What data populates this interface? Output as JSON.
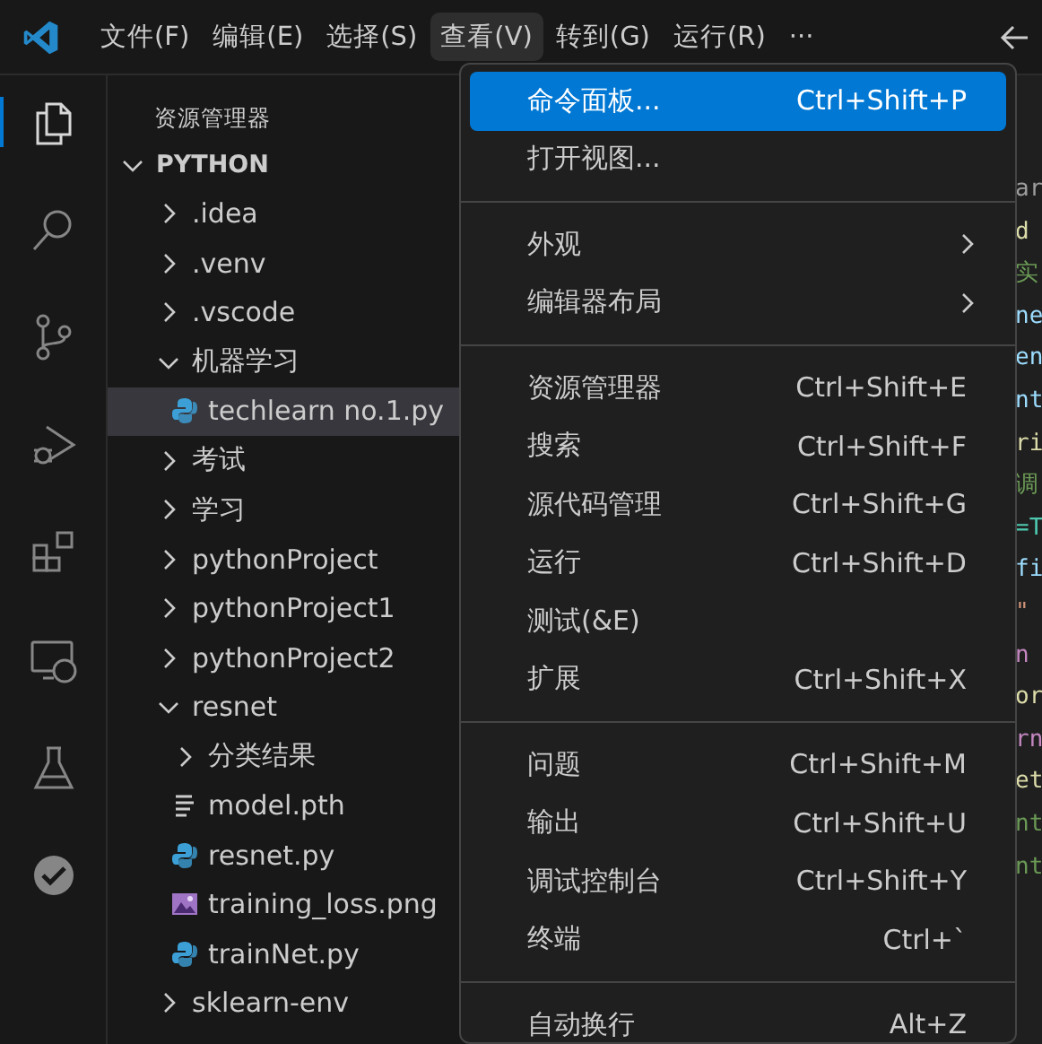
{
  "menubar": {
    "items": [
      {
        "label": "文件(F)",
        "selected": false
      },
      {
        "label": "编辑(E)",
        "selected": false
      },
      {
        "label": "选择(S)",
        "selected": false
      },
      {
        "label": "查看(V)",
        "selected": true
      },
      {
        "label": "转到(G)",
        "selected": false
      },
      {
        "label": "运行(R)",
        "selected": false
      },
      {
        "label": "···",
        "selected": false
      }
    ]
  },
  "activity_bar": {
    "items": [
      {
        "kind": "explorer",
        "selected": true
      },
      {
        "kind": "search",
        "selected": false
      },
      {
        "kind": "source-control",
        "selected": false
      },
      {
        "kind": "run-debug",
        "selected": false
      },
      {
        "kind": "extensions",
        "selected": false
      },
      {
        "kind": "remote",
        "selected": false
      },
      {
        "kind": "testing",
        "selected": false
      },
      {
        "kind": "check",
        "selected": false
      }
    ]
  },
  "sidebar": {
    "title": "资源管理器",
    "tree": {
      "label": "PYTHON",
      "expanded": true,
      "children": [
        {
          "kind": "folder",
          "label": ".idea",
          "expanded": false,
          "selected": false
        },
        {
          "kind": "folder",
          "label": ".venv",
          "expanded": false,
          "selected": false
        },
        {
          "kind": "folder",
          "label": ".vscode",
          "expanded": false,
          "selected": false
        },
        {
          "kind": "folder",
          "label": "机器学习",
          "expanded": true,
          "selected": false,
          "children": [
            {
              "kind": "python",
              "label": "techlearn no.1.py",
              "selected": true
            }
          ]
        },
        {
          "kind": "folder",
          "label": "考试",
          "expanded": false,
          "selected": false
        },
        {
          "kind": "folder",
          "label": "学习",
          "expanded": false,
          "selected": false
        },
        {
          "kind": "folder",
          "label": "pythonProject",
          "expanded": false,
          "selected": false
        },
        {
          "kind": "folder",
          "label": "pythonProject1",
          "expanded": false,
          "selected": false
        },
        {
          "kind": "folder",
          "label": "pythonProject2",
          "expanded": false,
          "selected": false
        },
        {
          "kind": "folder",
          "label": "resnet",
          "expanded": true,
          "selected": false,
          "children": [
            {
              "kind": "folder",
              "label": "分类结果",
              "expanded": false,
              "selected": false
            },
            {
              "kind": "lines",
              "label": "model.pth",
              "selected": false
            },
            {
              "kind": "python",
              "label": "resnet.py",
              "selected": false
            },
            {
              "kind": "image",
              "label": "training_loss.png",
              "selected": false
            },
            {
              "kind": "python",
              "label": "trainNet.py",
              "selected": false
            }
          ]
        },
        {
          "kind": "folder",
          "label": "sklearn-env",
          "expanded": false,
          "selected": false
        }
      ]
    }
  },
  "view_menu": {
    "groups": [
      {
        "items": [
          {
            "label": "命令面板...",
            "shortcut": "Ctrl+Shift+P",
            "selected": true,
            "submenu": false
          },
          {
            "label": "打开视图...",
            "selected": false,
            "submenu": false
          }
        ]
      },
      {
        "items": [
          {
            "label": "外观",
            "selected": false,
            "submenu": true
          },
          {
            "label": "编辑器布局",
            "selected": false,
            "submenu": true
          }
        ]
      },
      {
        "items": [
          {
            "label": "资源管理器",
            "shortcut": "Ctrl+Shift+E",
            "selected": false,
            "submenu": false
          },
          {
            "label": "搜索",
            "shortcut": "Ctrl+Shift+F",
            "selected": false,
            "submenu": false
          },
          {
            "label": "源代码管理",
            "shortcut": "Ctrl+Shift+G",
            "selected": false,
            "submenu": false
          },
          {
            "label": "运行",
            "shortcut": "Ctrl+Shift+D",
            "selected": false,
            "submenu": false
          },
          {
            "label": "测试(&E)",
            "selected": false,
            "submenu": false
          },
          {
            "label": "扩展",
            "shortcut": "Ctrl+Shift+X",
            "selected": false,
            "submenu": false
          }
        ]
      },
      {
        "items": [
          {
            "label": "问题",
            "shortcut": "Ctrl+Shift+M",
            "selected": false,
            "submenu": false
          },
          {
            "label": "输出",
            "shortcut": "Ctrl+Shift+U",
            "selected": false,
            "submenu": false
          },
          {
            "label": "调试控制台",
            "shortcut": "Ctrl+Shift+Y",
            "selected": false,
            "submenu": false
          },
          {
            "label": "终端",
            "shortcut": "Ctrl+`",
            "selected": false,
            "submenu": false
          }
        ]
      },
      {
        "items": [
          {
            "label": "自动换行",
            "shortcut": "Alt+Z",
            "selected": false,
            "submenu": false
          }
        ]
      }
    ]
  },
  "editor": {
    "fragments": [
      {
        "text": "ar",
        "color": "#9d9d9d"
      },
      {
        "text": "d",
        "color": "#dcdcaa"
      },
      {
        "text": "实",
        "color": "#6a9955"
      },
      {
        "text": "ne",
        "color": "#9cdcfe"
      },
      {
        "text": "en",
        "color": "#9cdcfe"
      },
      {
        "text": "nt",
        "color": "#9cdcfe"
      },
      {
        "text": "ri",
        "color": "#dcdcaa"
      },
      {
        "text": "调",
        "color": "#6a9955"
      },
      {
        "text": "=T",
        "color": "#4ec9b0"
      },
      {
        "text": "fi",
        "color": "#9cdcfe"
      },
      {
        "text": "\"",
        "color": "#ce9178"
      },
      {
        "text": "n",
        "color": "#c586c0"
      },
      {
        "text": "or",
        "color": "#dcdcaa"
      },
      {
        "text": "rn",
        "color": "#c586c0"
      },
      {
        "text": "et",
        "color": "#dcdcaa"
      },
      {
        "text": "nt",
        "color": "#6a9955"
      },
      {
        "text": "nt",
        "color": "#6a9955"
      }
    ]
  }
}
